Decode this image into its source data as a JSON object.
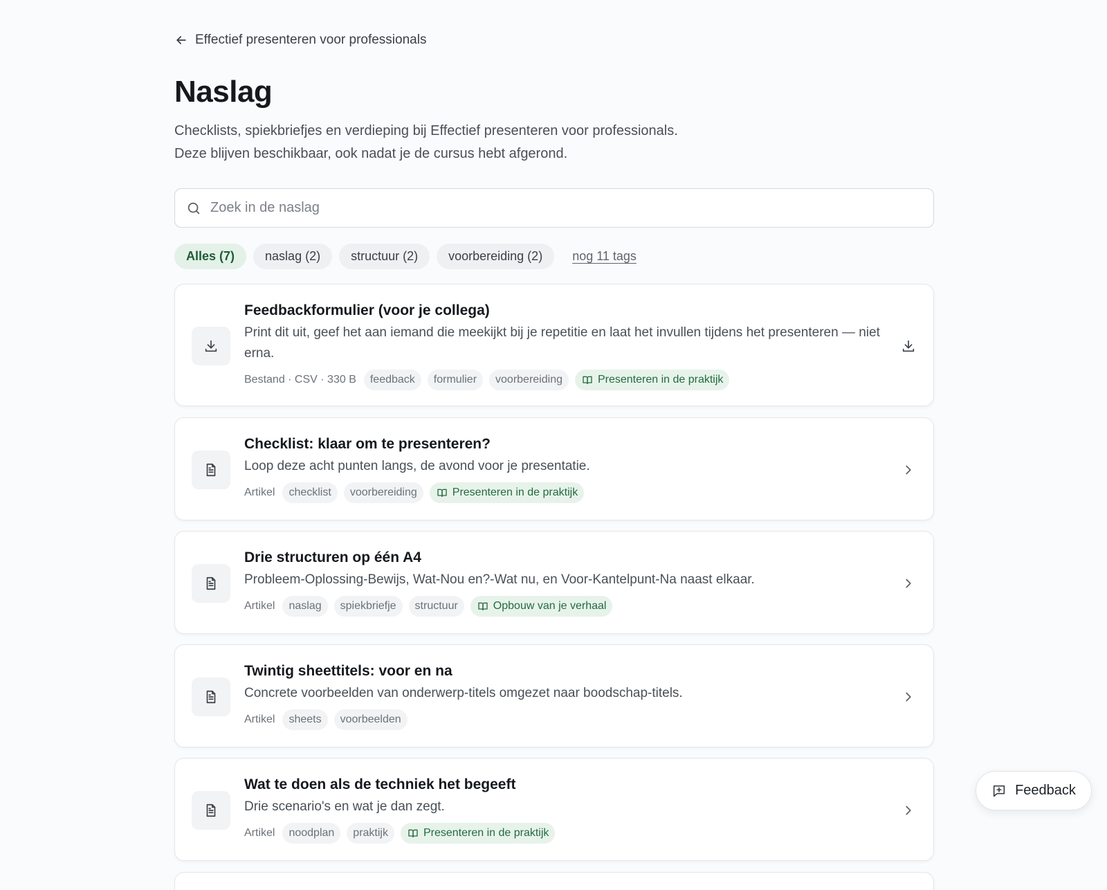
{
  "nav": {
    "back_label": "Effectief presenteren voor professionals"
  },
  "page": {
    "title": "Naslag",
    "intro_line1": "Checklists, spiekbriefjes en verdieping bij Effectief presenteren voor professionals.",
    "intro_line2": "Deze blijven beschikbaar, ook nadat je de cursus hebt afgerond."
  },
  "search": {
    "placeholder": "Zoek in de naslag",
    "value": ""
  },
  "filters": {
    "chips": [
      {
        "label": "Alles (7)",
        "active": true
      },
      {
        "label": "naslag (2)",
        "active": false
      },
      {
        "label": "structuur (2)",
        "active": false
      },
      {
        "label": "voorbereiding (2)",
        "active": false
      }
    ],
    "more_label": "nog 11 tags"
  },
  "items": [
    {
      "title": "Feedbackformulier (voor je collega)",
      "description": "Print dit uit, geef het aan iemand die meekijkt bij je repetitie en laat het invullen tijdens het presenteren — niet erna.",
      "kind": "Bestand · CSV · 330 B",
      "tags": [
        "feedback",
        "formulier",
        "voorbereiding"
      ],
      "module": "Presenteren in de praktijk",
      "icon": "download-icon",
      "action_icon": "download-icon"
    },
    {
      "title": "Checklist: klaar om te presenteren?",
      "description": "Loop deze acht punten langs, de avond voor je presentatie.",
      "kind": "Artikel",
      "tags": [
        "checklist",
        "voorbereiding"
      ],
      "module": "Presenteren in de praktijk",
      "icon": "document-icon",
      "action_icon": "chevron-right-icon"
    },
    {
      "title": "Drie structuren op één A4",
      "description": "Probleem-Oplossing-Bewijs, Wat-Nou en?-Wat nu, en Voor-Kantelpunt-Na naast elkaar.",
      "kind": "Artikel",
      "tags": [
        "naslag",
        "spiekbriefje",
        "structuur"
      ],
      "module": "Opbouw van je verhaal",
      "icon": "document-icon",
      "action_icon": "chevron-right-icon"
    },
    {
      "title": "Twintig sheettitels: voor en na",
      "description": "Concrete voorbeelden van onderwerp-titels omgezet naar boodschap-titels.",
      "kind": "Artikel",
      "tags": [
        "sheets",
        "voorbeelden"
      ],
      "module": "",
      "icon": "document-icon",
      "action_icon": "chevron-right-icon"
    },
    {
      "title": "Wat te doen als de techniek het begeeft",
      "description": "Drie scenario's en wat je dan zegt.",
      "kind": "Artikel",
      "tags": [
        "noodplan",
        "praktijk"
      ],
      "module": "Presenteren in de praktijk",
      "icon": "document-icon",
      "action_icon": "chevron-right-icon"
    }
  ],
  "feedback_button": {
    "label": "Feedback",
    "icon": "message-plus-icon"
  },
  "colors": {
    "accent_green": "#236b3f",
    "accent_green_bg": "#e7f3ea",
    "page_bg": "#fafbfc",
    "text": "#1d2329"
  }
}
